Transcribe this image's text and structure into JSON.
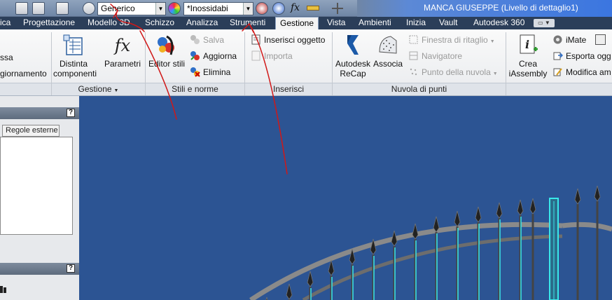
{
  "qat": {
    "material_value": "Generico",
    "appearance_value": "*Inossidabi",
    "fx_label": "fx"
  },
  "title": {
    "text": "MANCA GIUSEPPE (Livello di dettaglio1)"
  },
  "tabs": [
    {
      "label": "ica"
    },
    {
      "label": "Progettazione"
    },
    {
      "label": "Modello 3D"
    },
    {
      "label": "Schizzo"
    },
    {
      "label": "Analizza"
    },
    {
      "label": "Strumenti"
    },
    {
      "label": "Gestione"
    },
    {
      "label": "Vista"
    },
    {
      "label": "Ambienti"
    },
    {
      "label": "Inizia"
    },
    {
      "label": "Vault"
    },
    {
      "label": "Autodesk 360"
    }
  ],
  "ribbon": {
    "left_cut1": "ssa",
    "left_cut2": "giornamento",
    "distinta": "Distinta componenti",
    "parametri": "Parametri",
    "editor_stili": "Editor stili",
    "salva": "Salva",
    "aggiorna": "Aggiorna",
    "elimina": "Elimina",
    "inserisci_oggetto": "Inserisci oggetto",
    "importa": "Importa",
    "recap": "Autodesk ReCap",
    "associa": "Associa",
    "finestra_ritaglio": "Finestra di ritaglio",
    "navigatore": "Navigatore",
    "punto_nuvola": "Punto della nuvola",
    "crea_iassembly": "Crea iAssembly",
    "imate": "iMate",
    "esporta": "Esporta ogg",
    "modifica": "Modifica am"
  },
  "panels": {
    "gestione": "Gestione",
    "stili": "Stili e norme",
    "inserisci": "Inserisci",
    "nuvola": "Nuvola di punti"
  },
  "browser": {
    "regole_tab": "Regole esterne",
    "help": "?"
  },
  "colors": {
    "viewport": "#2c5493",
    "annotation": "#d01818",
    "highlight": "#39e8ea"
  }
}
